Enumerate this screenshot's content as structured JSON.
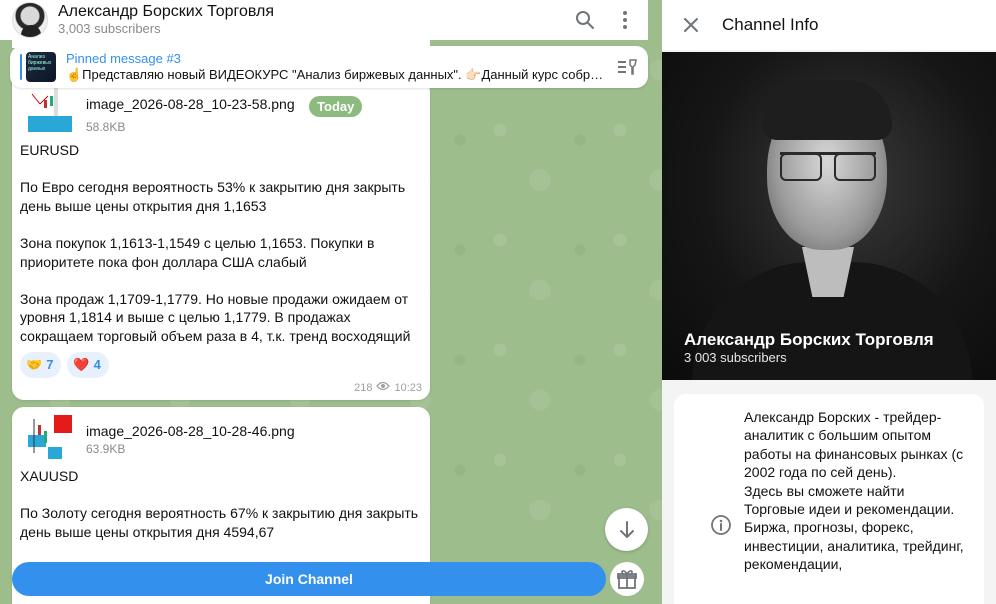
{
  "chat": {
    "channel_name": "Александр Борских Торговля",
    "subscribers": "3,003 subscribers",
    "pinned": {
      "title": "Pinned message #3",
      "thumb_text": "Анализ биржевых данных",
      "body": "☝️Представляю новый ВИДЕОКУРС \"Анализ биржевых данных\". 👉🏻Данный курс собра..."
    },
    "messages": [
      {
        "file_name": "image_2026-08-28_10-23-58.png",
        "file_size": "58.8KB",
        "badge": "Today",
        "text": "EURUSD\n\nПо Евро сегодня вероятность 53% к закрытию дня закрыть день выше цены открытия дня 1,1653\n\nЗона покупок 1,1613-1,1549 с целью 1,1653. Покупки в приоритете пока фон доллара США слабый\n\nЗона продаж 1,1709-1,1779. Но новые продажи ожидаем от уровня 1,1814 и выше с целью 1,1779. В продажах сокращаем торговый объем раза в 4, т.к. тренд восходящий",
        "reactions": [
          {
            "emoji": "🤝",
            "count": "7"
          },
          {
            "emoji": "❤️",
            "count": "4"
          }
        ],
        "views": "218",
        "time": "10:23"
      },
      {
        "file_name": "image_2026-08-28_10-28-46.png",
        "file_size": "63.9KB",
        "text": "XAUUSD\n\nПо Золоту сегодня вероятность 67% к закрытию дня закрыть день выше цены открытия дня 4594,67"
      }
    ],
    "join_label": "Join Channel"
  },
  "info": {
    "title": "Channel Info",
    "name": "Александр Борских Торговля",
    "subscribers": "3 003 subscribers",
    "about": "Александр Борских - трейдер-аналитик с большим опытом работы на финансовых рынках (с 2002 года по сей день).\nЗдесь вы сможете найти Торговые идеи и рекомендации. Биржа, прогнозы, форекс, инвестиции, аналитика, трейдинг, рекомендации,"
  },
  "colors": {
    "accent": "#3390ec",
    "badge": "#8dbb7f",
    "chat_bg": "#9dbd8d"
  }
}
